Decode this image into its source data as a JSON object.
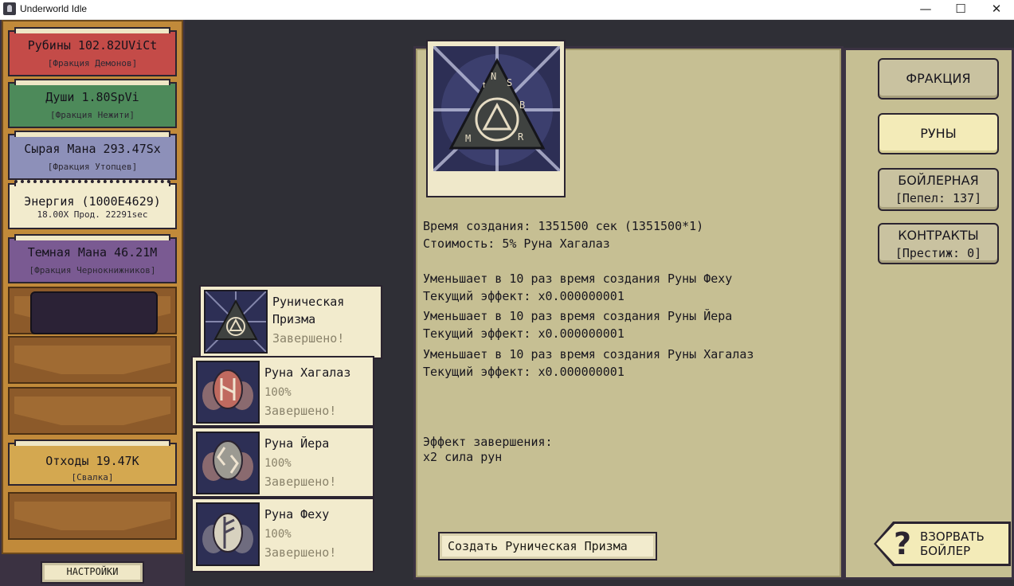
{
  "window": {
    "title": "Underworld Idle",
    "minimize": "—",
    "maximize": "☐",
    "close": "✕"
  },
  "resources": [
    {
      "name": "Рубины 102.82UViCt",
      "sub": "[Фракция Демонов]",
      "color": "#c44b48"
    },
    {
      "name": "Души 1.80SpVi",
      "sub": "[Фракция Нежити]",
      "color": "#4d8a5a"
    },
    {
      "name": "Сырая Мана 293.47Sx",
      "sub": "[Фракция Утопцев]",
      "color": "#8d90b9"
    },
    {
      "name": "Энергия (1000E4629)",
      "sub": "18.00X Прод. 22291sec",
      "color": "#f2ebcd"
    },
    {
      "name": "Темная Мана 46.21M",
      "sub": "[Фракция Чернокнижников]",
      "color": "#7a5a92"
    },
    {
      "name": "Отходы 19.47K",
      "sub": "[Свалка]",
      "color": "#d4a850"
    }
  ],
  "settings_label": "НАСТРОЙКИ",
  "tasks": [
    {
      "name": "Руническая Призма",
      "percent": "",
      "status": "Завершено!"
    },
    {
      "name": "Руна Хагалаз",
      "percent": "100%",
      "status": "Завершено!"
    },
    {
      "name": "Руна Йера",
      "percent": "100%",
      "status": "Завершено!"
    },
    {
      "name": "Руна Феху",
      "percent": "100%",
      "status": "Завершено!"
    }
  ],
  "detail": {
    "time": "Время создания: 1351500 сек  (1351500*1)",
    "cost": "Стоимость: 5% Руна Хагалаз",
    "effects": [
      {
        "desc": "Уменьшает в 10 раз время создания Руны Феху",
        "current": "Текущий эффект: x0.000000001"
      },
      {
        "desc": "Уменьшает в 10 раз время создания Руны Йера",
        "current": "Текущий эффект: x0.000000001"
      },
      {
        "desc": "Уменьшает в 10 раз время создания Руны Хагалаз",
        "current": "Текущий эффект: x0.000000001"
      }
    ],
    "completion_title": "Эффект завершения:",
    "completion_value": "x2 сила рун",
    "create_button": "Создать Руническая Призма"
  },
  "nav": {
    "faction": "ФРАКЦИЯ",
    "runes": "РУНЫ",
    "boiler": "БОЙЛЕРНАЯ",
    "boiler_sub": "[Пепел: 137]",
    "contracts": "КОНТРАКТЫ",
    "contracts_sub": "[Престиж: 0]",
    "blow_line1": "ВЗОРВАТЬ",
    "blow_line2": "БОЙЛЕР",
    "blow_icon": "?"
  }
}
